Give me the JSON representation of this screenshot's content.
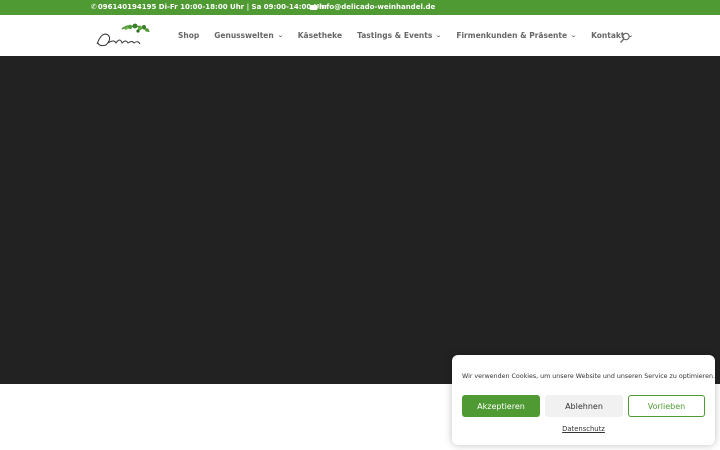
{
  "colors": {
    "brand": "#4f9a33",
    "hero": "#222222"
  },
  "topbar": {
    "phone_icon": "phone-icon",
    "phone": "096140194195",
    "hours": "Di-Fr 10:00-18:00 Uhr | Sa 09:00-14:00 Uhr",
    "mail_icon": "envelope-icon",
    "email": "info@delicado-weinhandel.de"
  },
  "header": {
    "logo_icon": "delicado-logo",
    "nav": [
      {
        "label": "Shop",
        "dropdown": false
      },
      {
        "label": "Genusswelten",
        "dropdown": true
      },
      {
        "label": "Käsetheke",
        "dropdown": false
      },
      {
        "label": "Tastings & Events",
        "dropdown": true
      },
      {
        "label": "Firmenkunden & Präsente",
        "dropdown": true
      },
      {
        "label": "Kontakt",
        "dropdown": true
      }
    ],
    "search_icon": "search-icon"
  },
  "cookie": {
    "text": "Wir verwenden Cookies, um unsere Website und unseren Service zu optimieren.",
    "accept": "Akzeptieren",
    "deny": "Ablehnen",
    "preferences": "Vorlieben",
    "privacy": "Datenschutz"
  }
}
